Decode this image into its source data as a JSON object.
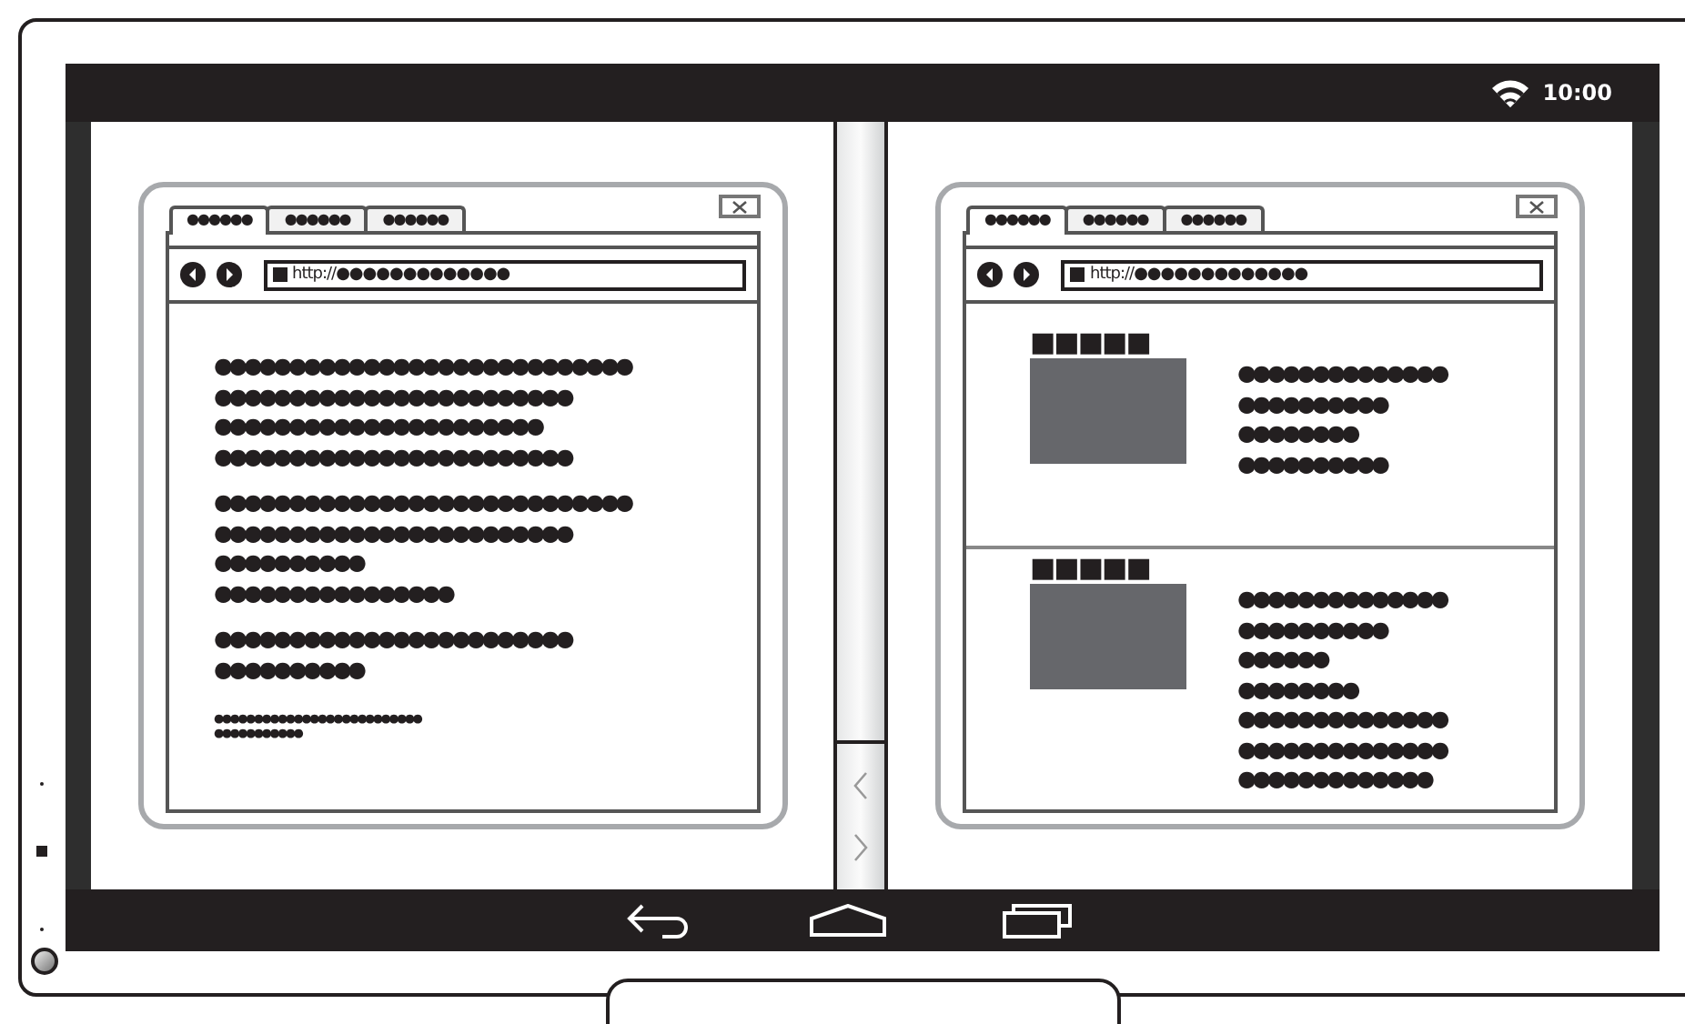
{
  "status_bar": {
    "time": "10:00"
  },
  "panes": [
    {
      "kind": "article",
      "tabs": [
        {
          "label": "●●●●●●",
          "selected": true
        },
        {
          "label": "●●●●●●",
          "selected": false
        },
        {
          "label": "●●●●●●",
          "selected": false
        }
      ],
      "address": "http://●●●●●●●●●●●●●",
      "paragraphs": [
        [
          "●●●●●●●●●●●●●●●●●●●●●●●●●●●●",
          "●●●●●●●●●●●●●●●●●●●●●●●●",
          "●●●●●●●●●●●●●●●●●●●●●●",
          "●●●●●●●●●●●●●●●●●●●●●●●●"
        ],
        [
          "●●●●●●●●●●●●●●●●●●●●●●●●●●●●",
          "●●●●●●●●●●●●●●●●●●●●●●●●",
          "●●●●●●●●●●",
          "●●●●●●●●●●●●●●●●"
        ],
        [
          "●●●●●●●●●●●●●●●●●●●●●●●●",
          "●●●●●●●●●●"
        ]
      ],
      "footnote": [
        "●●●●●●●●●●●●●●●●●●●●●●●●●●",
        "●●●●●●●●●●●"
      ]
    },
    {
      "kind": "listing",
      "tabs": [
        {
          "label": "●●●●●●",
          "selected": true
        },
        {
          "label": "●●●●●●",
          "selected": false
        },
        {
          "label": "●●●●●●",
          "selected": false
        }
      ],
      "address": "http://●●●●●●●●●●●●●",
      "entries": [
        {
          "heading": "■■■■■",
          "lines": [
            "●●●●●●●●●●●●●●",
            "●●●●●●●●●●",
            "●●●●●●●●",
            "●●●●●●●●●●"
          ]
        },
        {
          "heading": "■■■■■",
          "lines": [
            "●●●●●●●●●●●●●●",
            "●●●●●●●●●●",
            "●●●●●●",
            "●●●●●●●●",
            "●●●●●●●●●●●●●●",
            "●●●●●●●●●●●●●●",
            "●●●●●●●●●●●●●"
          ]
        }
      ]
    }
  ]
}
